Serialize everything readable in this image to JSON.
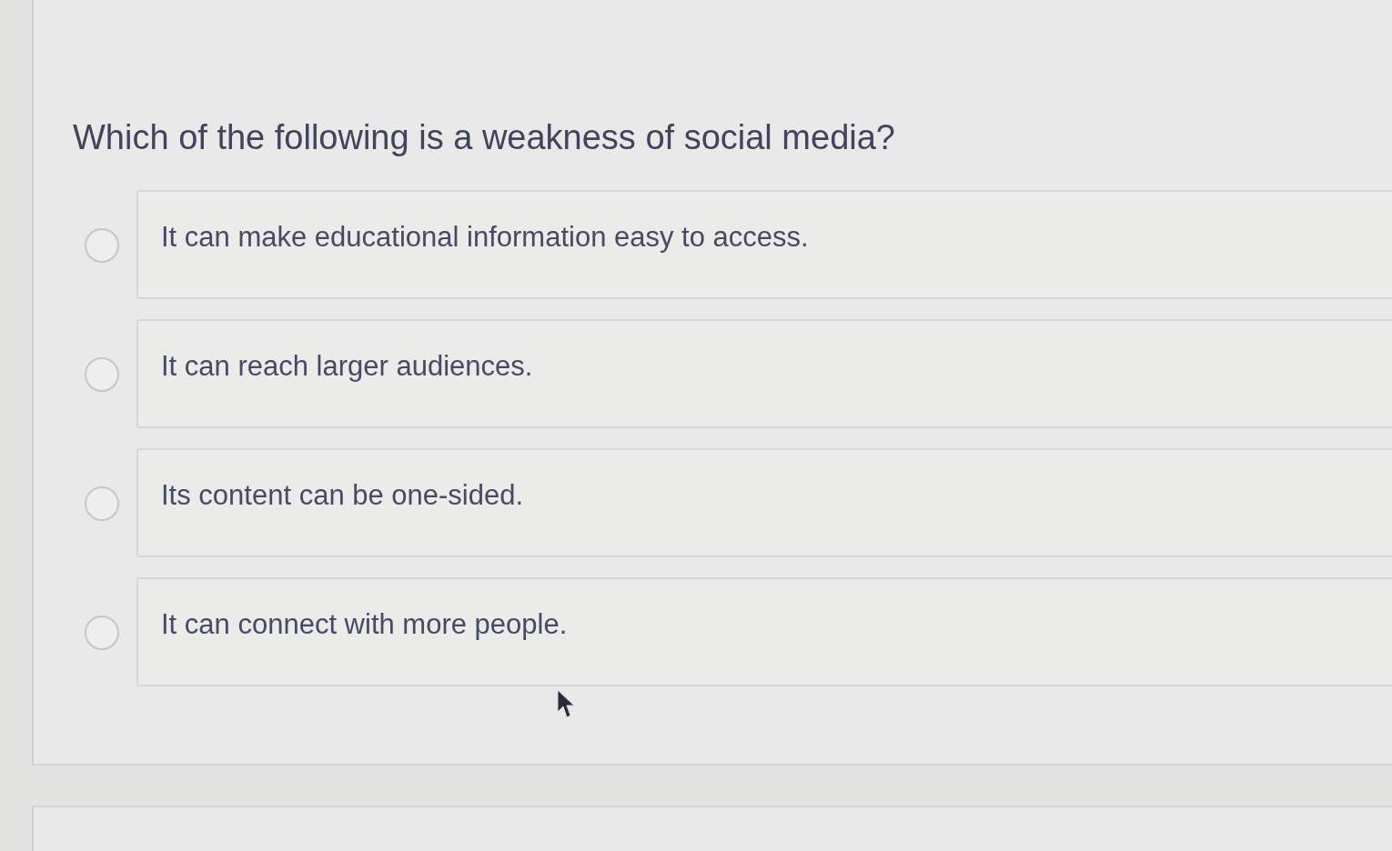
{
  "question": {
    "text": "Which of the following is a weakness of social media?"
  },
  "options": [
    {
      "label": "It can make educational information easy to access.",
      "selected": false
    },
    {
      "label": "It can reach larger audiences.",
      "selected": false
    },
    {
      "label": "Its content can be one-sided.",
      "selected": false
    },
    {
      "label": "It can connect with more people.",
      "selected": false
    }
  ]
}
